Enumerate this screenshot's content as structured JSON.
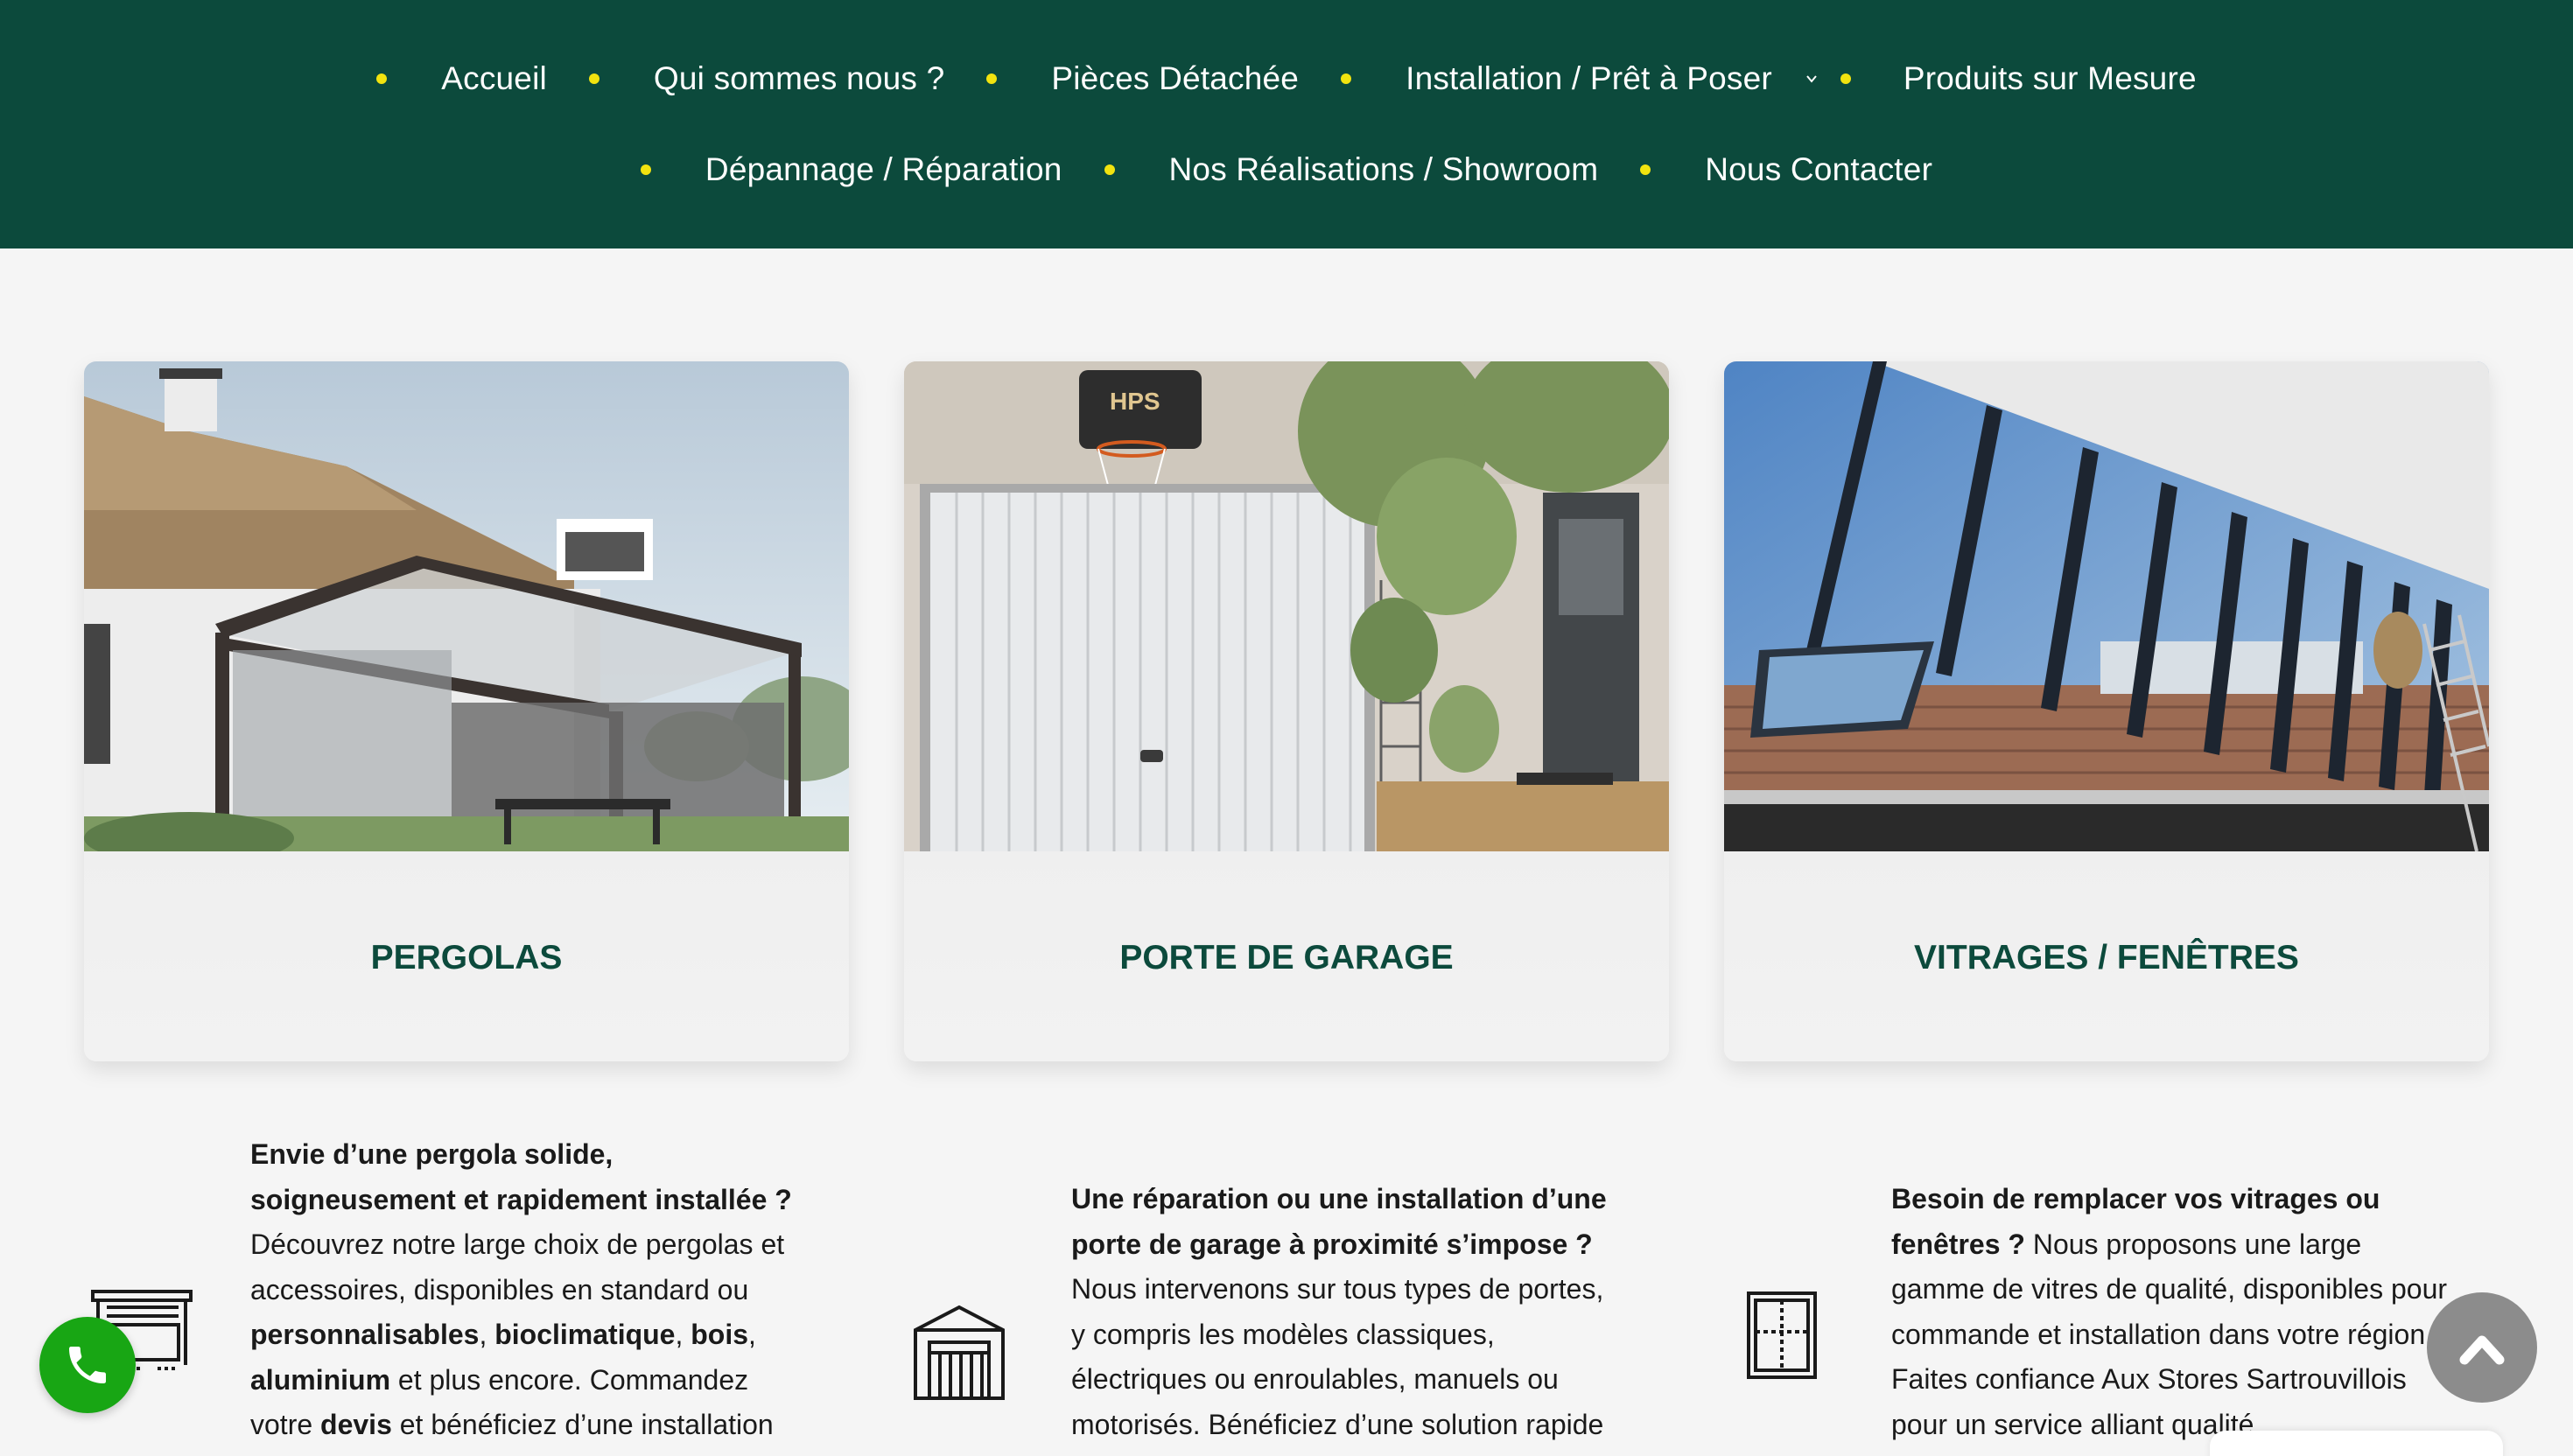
{
  "nav": {
    "row1": [
      "Accueil",
      "Qui sommes nous ?",
      "Pièces Détachée",
      "Installation / Prêt à Poser",
      "Produits sur Mesure"
    ],
    "row2": [
      "Dépannage / Réparation",
      "Nos Réalisations / Showroom",
      "Nous Contacter"
    ]
  },
  "cards": [
    {
      "title": "PERGOLAS"
    },
    {
      "title": "PORTE DE GARAGE"
    },
    {
      "title": "VITRAGES / FENÊTRES"
    }
  ],
  "features": {
    "pergola": {
      "b1": "Envie d’une pergola solide, soigneusement et rapidement installée ?",
      "t1": " Découvrez notre large choix de pergolas et accessoires, disponibles en standard ou ",
      "b2": "personnalisables",
      "t2": ", ",
      "b3": "bioclimatique",
      "t3": ", ",
      "b4": "bois",
      "t4": ", ",
      "b5": "aluminium",
      "t5": " et plus encore. Commandez votre ",
      "b6": "devis",
      "t6": " et bénéficiez d’une installation"
    },
    "garage": {
      "b1": "Une réparation ou une installation d’une porte de garage à proximité s’impose ?",
      "t1": " Nous intervenons sur tous types de portes, y compris les modèles classiques, électriques ou enroulables, manuels ou motorisés. Bénéficiez d’une solution rapide"
    },
    "vitrage": {
      "b1": "Besoin de remplacer vos vitrages ou fenêtres ?",
      "t1": " Nous proposons une large gamme de vitres de qualité, disponibles pour commande et installation dans votre région. Faites confiance Aux Stores Sartrouvillois pour un service alliant qualité"
    }
  },
  "colors": {
    "nav_bg": "#0c4a3c",
    "nav_dot": "#f2e30f",
    "card_title": "#0c4a3c",
    "call_button": "#18a614",
    "scroll_top": "#8c8c8c"
  },
  "icons": [
    "chevron-down-icon",
    "pergola-icon",
    "garage-icon",
    "window-icon",
    "phone-icon",
    "arrow-up-icon"
  ]
}
